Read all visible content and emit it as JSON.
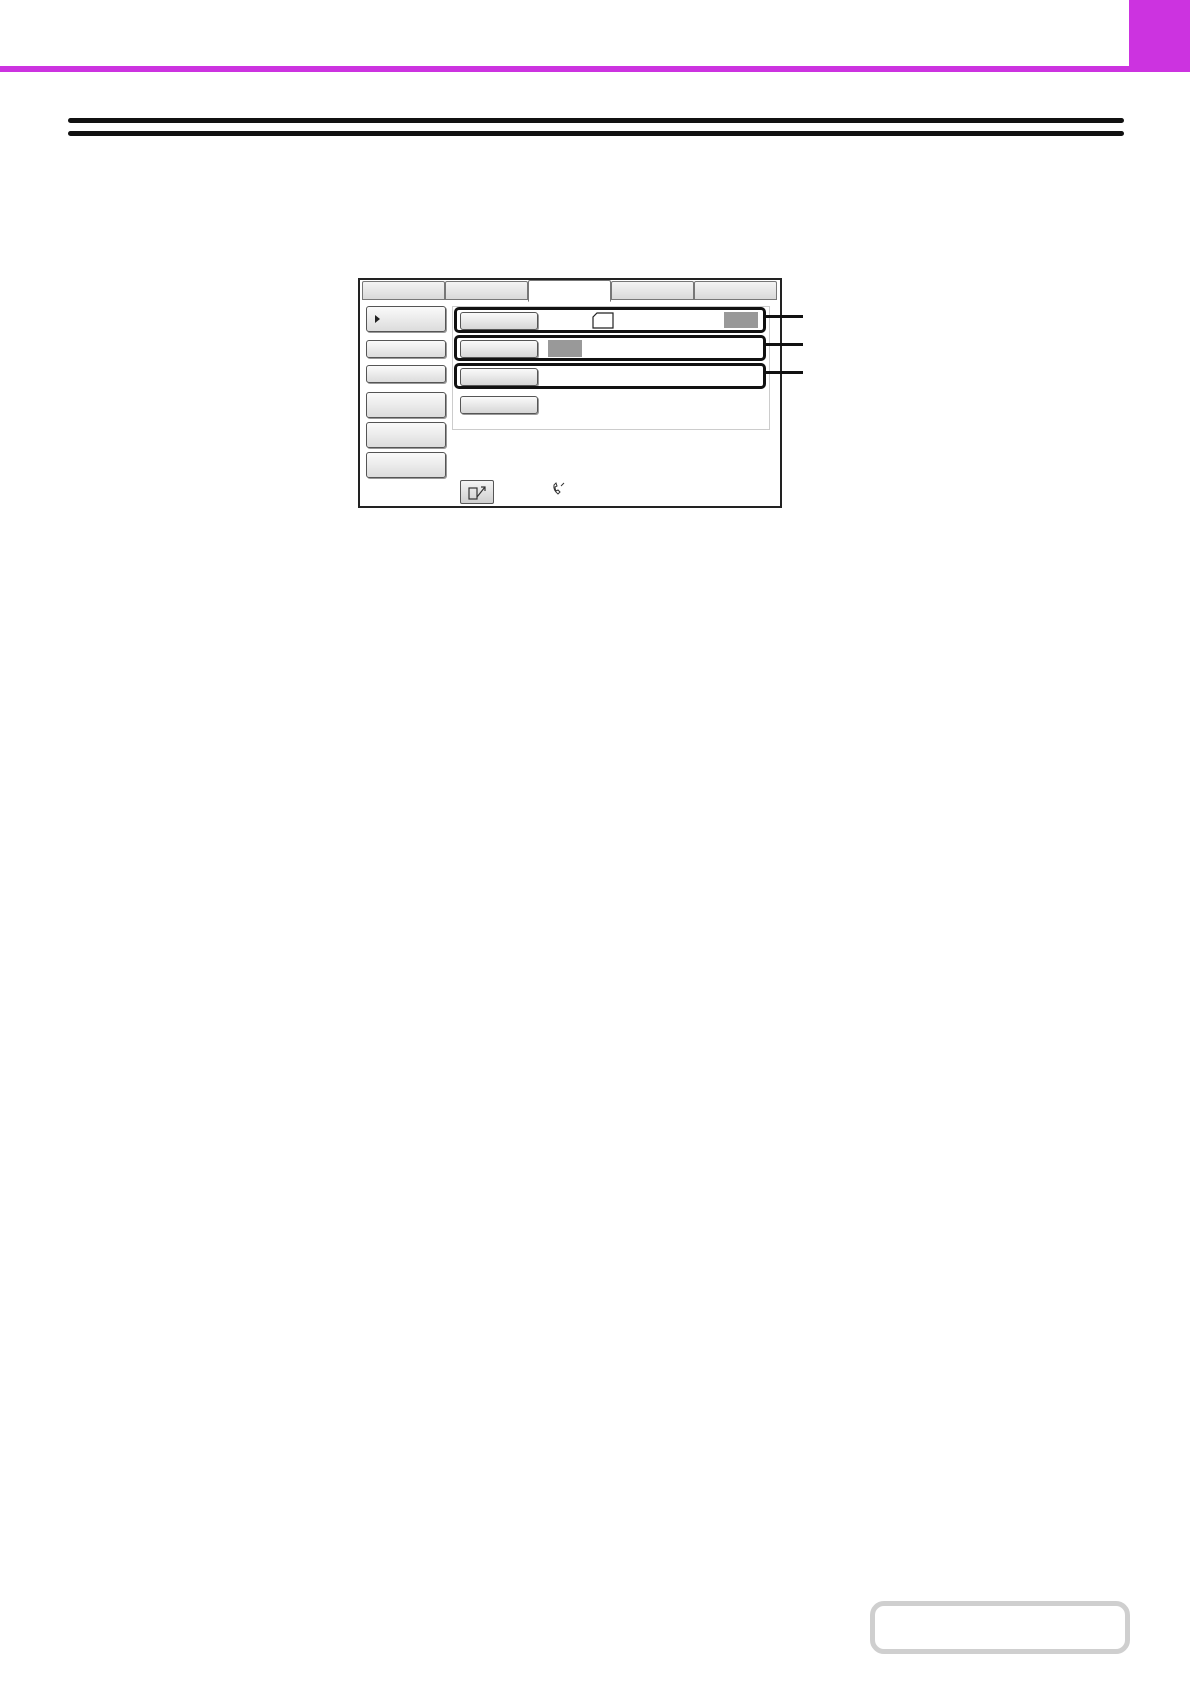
{
  "colors": {
    "accent": "#cc33e0",
    "rule": "#111111",
    "gray_indicator": "#999999"
  },
  "icons": {
    "pointer": "arrow-right-icon",
    "paper": "paper-sheet-icon",
    "home": "home-icon",
    "status": "fax-status-icon"
  },
  "callouts": {
    "count": 3
  }
}
